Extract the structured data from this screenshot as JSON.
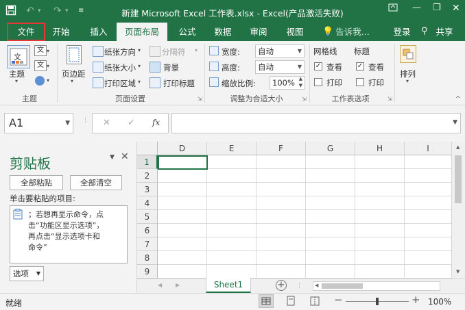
{
  "titlebar": {
    "title": "新建 Microsoft Excel 工作表.xlsx - Excel(产品激活失败)",
    "save_icon": "save-icon",
    "undo_icon": "undo-icon",
    "redo_icon": "redo-icon",
    "customize_icon": "customize-quick-access-icon"
  },
  "tabs": [
    "文件",
    "开始",
    "插入",
    "页面布局",
    "公式",
    "数据",
    "审阅",
    "视图"
  ],
  "active_tab": "页面布局",
  "tellme": "告诉我...",
  "login": "登录",
  "share": "共享",
  "ribbon": {
    "themes": {
      "theme_label": "主题",
      "colors_glyph": "文",
      "group_label": "主题"
    },
    "page_setup": {
      "margins_label": "页边距",
      "orientation_label": "纸张方向",
      "size_label": "纸张大小",
      "print_area_label": "打印区域",
      "breaks_label": "分隔符",
      "background_label": "背景",
      "print_titles_label": "打印标题",
      "group_label": "页面设置"
    },
    "scale": {
      "width_label": "宽度:",
      "width_value": "自动",
      "height_label": "高度:",
      "height_value": "自动",
      "scale_label": "缩放比例:",
      "scale_value": "100%",
      "group_label": "调整为合适大小"
    },
    "sheet_options": {
      "gridlines_label": "网格线",
      "headings_label": "标题",
      "view_label": "查看",
      "print_label": "打印",
      "gridlines_view": true,
      "gridlines_print": false,
      "headings_view": true,
      "headings_print": false,
      "group_label": "工作表选项"
    },
    "arrange": {
      "arrange_label": "排列"
    }
  },
  "formula_bar": {
    "name_box": "A1",
    "cancel": "✕",
    "enter": "✓",
    "fx": "fx",
    "formula": ""
  },
  "clipboard": {
    "title": "剪贴板",
    "paste_all": "全部粘贴",
    "clear_all": "全部清空",
    "instructions": "单击要粘贴的项目:",
    "item_lines": [
      "；若想再显示命令，点",
      "击“功能区显示选项”，",
      "再点击“显示选项卡和",
      "命令”"
    ],
    "options_label": "选项"
  },
  "grid": {
    "columns": [
      "D",
      "E",
      "F",
      "G",
      "H",
      "I"
    ],
    "rows": [
      "1",
      "2",
      "3",
      "4",
      "5",
      "6",
      "7",
      "8",
      "9"
    ]
  },
  "sheet_tab": "Sheet1",
  "status": {
    "ready": "就绪",
    "zoom": "100%",
    "zoom_percent": 100
  }
}
